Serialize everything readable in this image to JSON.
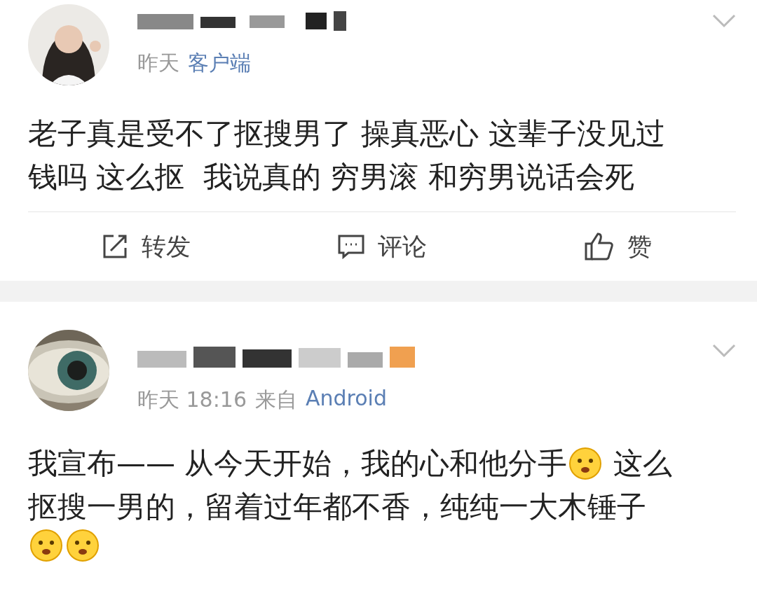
{
  "posts": [
    {
      "time": "昨天",
      "source": "客户端",
      "body": [
        [
          {
            "kind": "text",
            "text": "老子真是受不了抠搜男了 操真恶心 这辈子没见过"
          }
        ],
        [
          {
            "kind": "text",
            "text": "钱吗 这么抠  我说真的 穷男滚 和穷男说话会死"
          }
        ]
      ],
      "actions": [
        {
          "kind": "repost",
          "label": "转发"
        },
        {
          "kind": "comment",
          "label": "评论"
        },
        {
          "kind": "like",
          "label": "赞"
        }
      ]
    },
    {
      "time": "昨天 18:16",
      "source_prefix": "来自",
      "source": "Android",
      "body": [
        [
          {
            "kind": "text",
            "text": "我宣布—— 从今天开始，我的心和他分手"
          },
          {
            "kind": "emoji"
          },
          {
            "kind": "text",
            "text": " 这么"
          }
        ],
        [
          {
            "kind": "text",
            "text": "抠搜一男的，留着过年都不香，纯纯一大木锤子"
          }
        ],
        [
          {
            "kind": "emoji"
          },
          {
            "kind": "emoji"
          }
        ]
      ]
    }
  ]
}
